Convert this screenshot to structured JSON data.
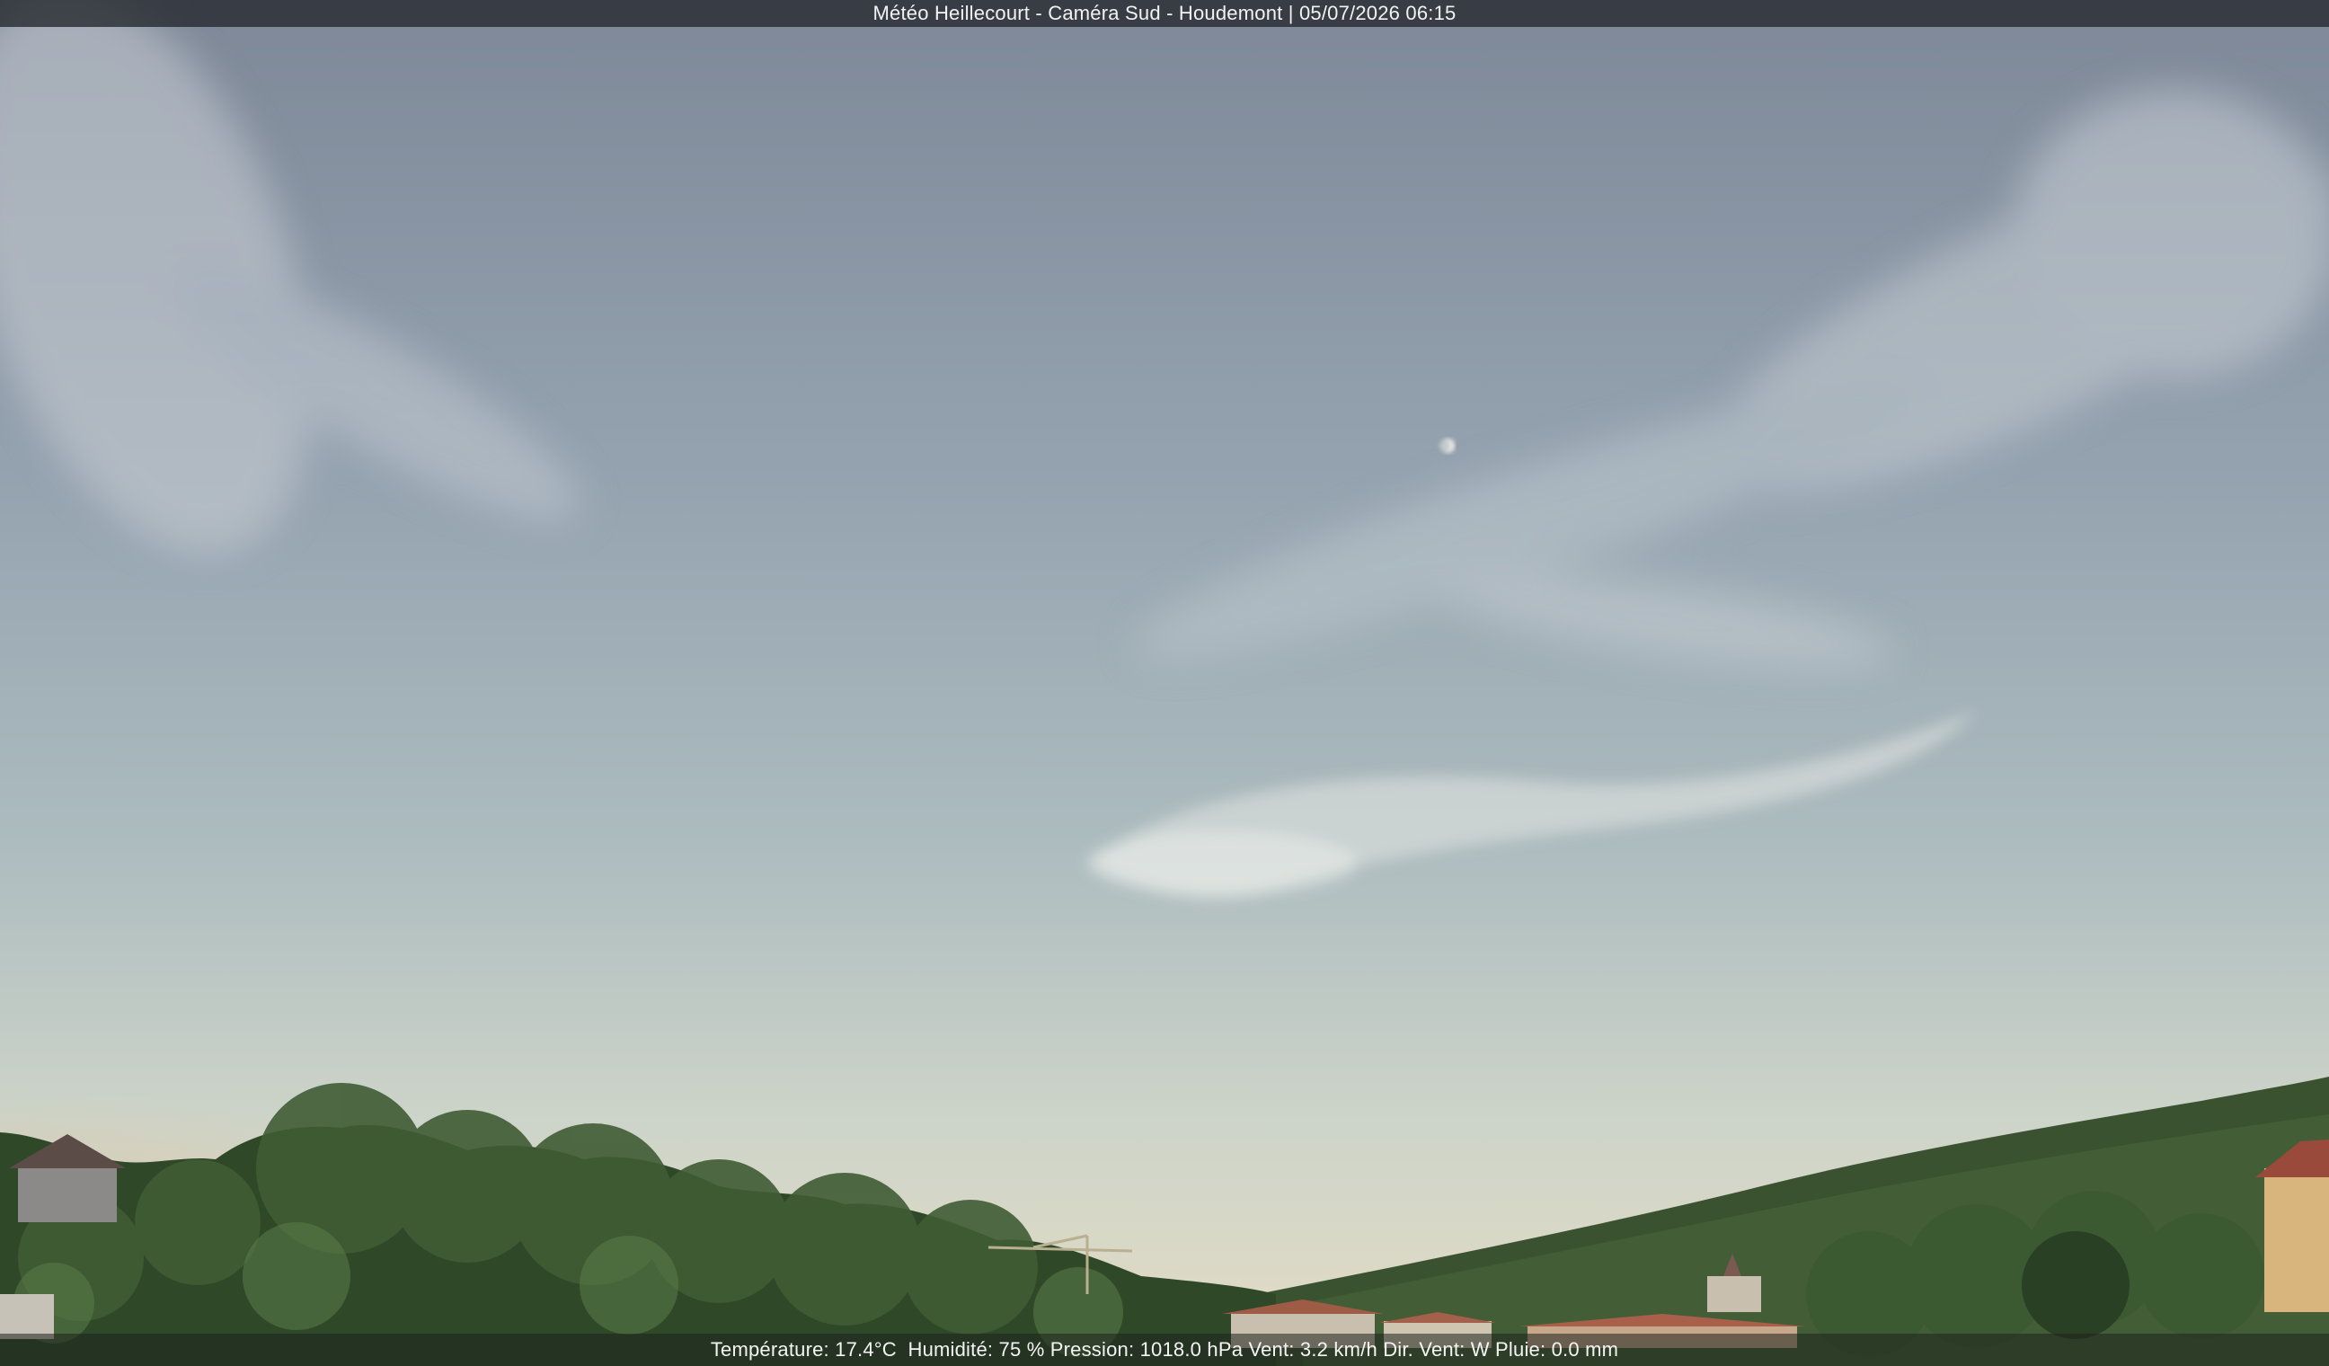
{
  "header": {
    "caption": "Météo Heillecourt - Caméra Sud - Houdemont | 05/07/2026 06:15"
  },
  "footer": {
    "weather_readout": "Température: 17.4°C  Humidité: 75 % Pression: 1018.0 hPa Vent: 3.2 km/h Dir. Vent: W Pluie: 0.0 mm"
  },
  "colors": {
    "sky_top": "#7f8a9a",
    "sky_mid": "#a9b6bd",
    "sky_horizon": "#d8d8c8",
    "horizon_glow": "#e8c89a",
    "foliage": "#3c5530",
    "roofs": "#a8604a"
  }
}
